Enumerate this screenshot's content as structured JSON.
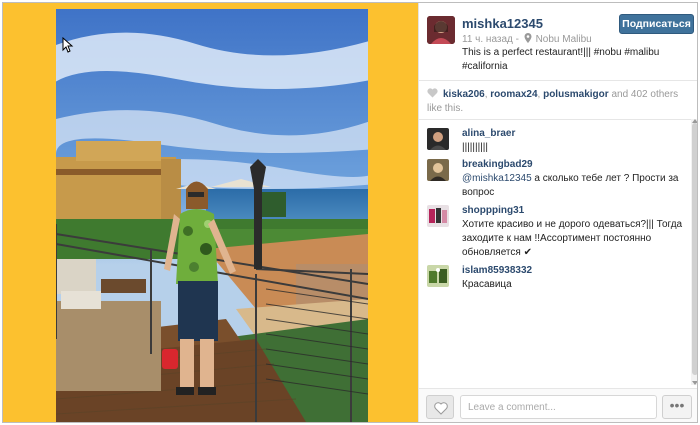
{
  "post": {
    "username": "mishka12345",
    "follow_label": "Подписаться",
    "time_ago": "11 ч. назад -",
    "location": "Nobu Malibu",
    "caption": "This is a perfect restaurant!||| #nobu #malibu #california"
  },
  "likes": {
    "user1": "kiska206",
    "sep1": ", ",
    "user2": "roomax24",
    "sep2": ", ",
    "user3": "polusmakigor",
    "and_text": " and ",
    "count": "402",
    "others_text": " others like this."
  },
  "comments": [
    {
      "user": "alina_braer",
      "text": "||||||||||"
    },
    {
      "user": "breakingbad29",
      "mention": "@mishka12345",
      "text": " а сколько тебе лет ? Прости за вопрос"
    },
    {
      "user": "shoppping31",
      "text": "Хотите красиво и не дорого одеваться?||| Тогда заходите к нам !!Ассортимент постоянно обновляется ✔"
    },
    {
      "user": "islam85938332",
      "text": "Красавица"
    }
  ],
  "footer": {
    "comment_placeholder": "Leave a comment...",
    "more_label": "•••"
  },
  "colors": {
    "background_yellow": "#fcc12f",
    "follow_button": "#3f729b",
    "username_link": "#2c4a6e"
  },
  "icons": {
    "location": "pin-icon",
    "like": "heart-icon",
    "cursor": "mouse-pointer-icon"
  }
}
